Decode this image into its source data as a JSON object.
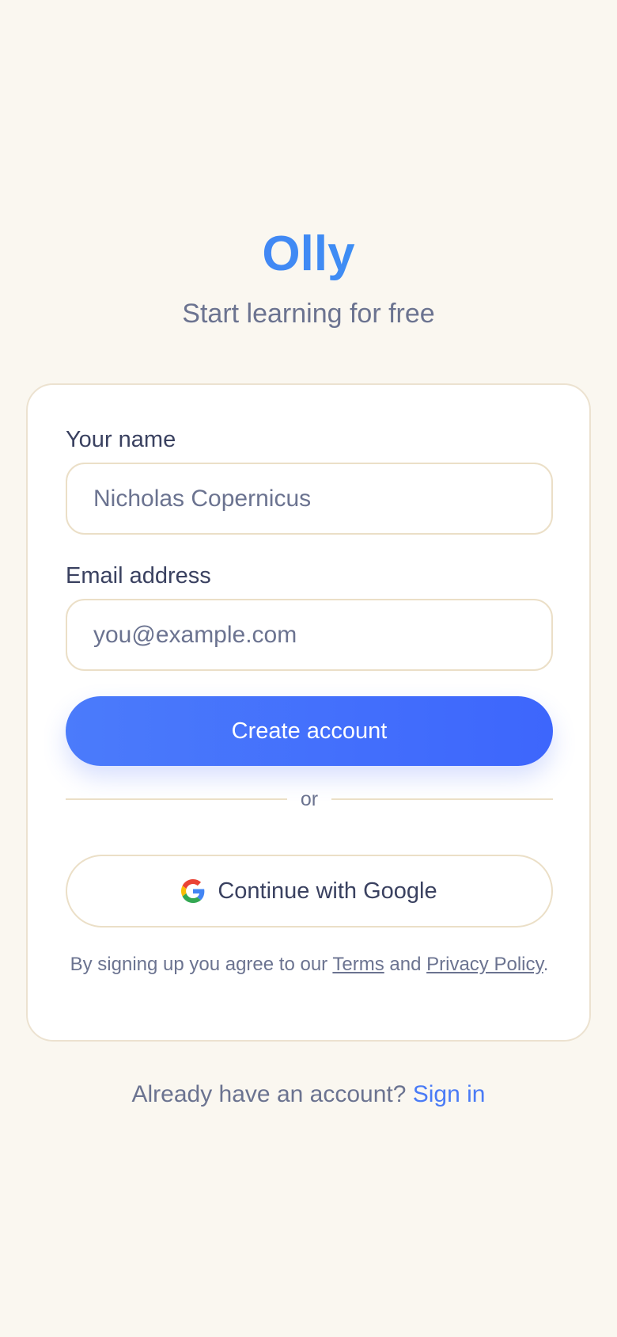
{
  "brand": {
    "name": "Olly",
    "tagline": "Start learning for free"
  },
  "form": {
    "name_label": "Your name",
    "name_placeholder": "Nicholas Copernicus",
    "name_value": "",
    "email_label": "Email address",
    "email_placeholder": "you@example.com",
    "email_value": "",
    "submit_label": "Create account",
    "divider_text": "or",
    "google_label": "Continue with Google"
  },
  "legal": {
    "prefix": "By signing up you agree to our ",
    "terms_label": "Terms",
    "conjunction": " and ",
    "privacy_label": "Privacy Policy",
    "suffix": "."
  },
  "footer": {
    "prompt": "Already have an account? ",
    "signin_label": "Sign in"
  },
  "colors": {
    "background": "#faf7f0",
    "accent": "#4a7bf6",
    "muted_text": "#6b7390",
    "heading_text": "#3a4160",
    "border": "#ebdfc7"
  },
  "icons": {
    "google": "google-g-logo-icon"
  }
}
